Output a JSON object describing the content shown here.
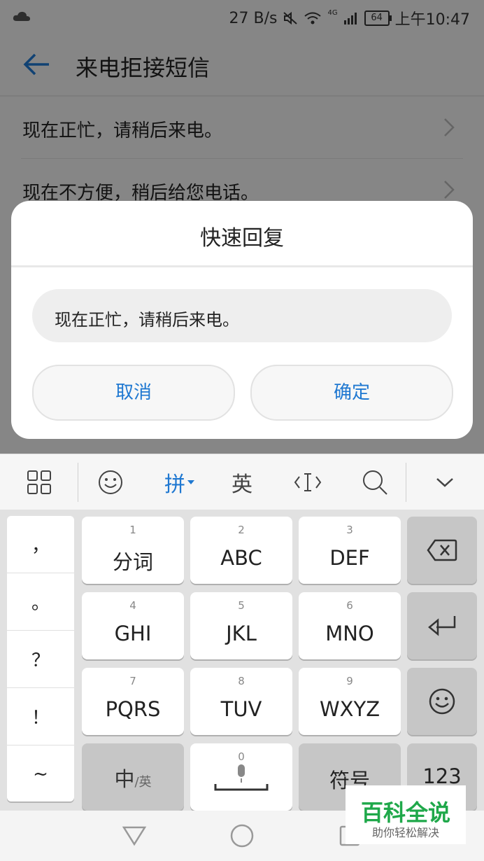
{
  "status_bar": {
    "speed": "27 B/s",
    "network": "4G",
    "battery": "64",
    "time": "上午10:47"
  },
  "app_bar": {
    "title": "来电拒接短信"
  },
  "list": {
    "items": [
      "现在正忙，请稍后来电。",
      "现在不方便，稍后给您电话。"
    ]
  },
  "dialog": {
    "title": "快速回复",
    "input_value": "现在正忙，请稍后来电。",
    "cancel_label": "取消",
    "ok_label": "确定"
  },
  "keyboard_toolbar": {
    "pinyin_label": "拼",
    "english_label": "英"
  },
  "keyboard": {
    "punctuation": [
      "，",
      "。",
      "？",
      "！",
      "~"
    ],
    "keys": [
      {
        "num": "1",
        "label": "分词"
      },
      {
        "num": "2",
        "label": "ABC"
      },
      {
        "num": "3",
        "label": "DEF"
      },
      {
        "num": "4",
        "label": "GHI"
      },
      {
        "num": "5",
        "label": "JKL"
      },
      {
        "num": "6",
        "label": "MNO"
      },
      {
        "num": "7",
        "label": "PQRS"
      },
      {
        "num": "8",
        "label": "TUV"
      },
      {
        "num": "9",
        "label": "WXYZ"
      }
    ],
    "space_num": "0",
    "zh_label": "中",
    "en_label": "/英",
    "symbol_label": "符号",
    "num_label": "123"
  },
  "watermark": {
    "title": "百科全说",
    "subtitle": "助你轻松解决"
  },
  "colors": {
    "accent": "#1f78d1",
    "watermark_green": "#1fa84a"
  }
}
